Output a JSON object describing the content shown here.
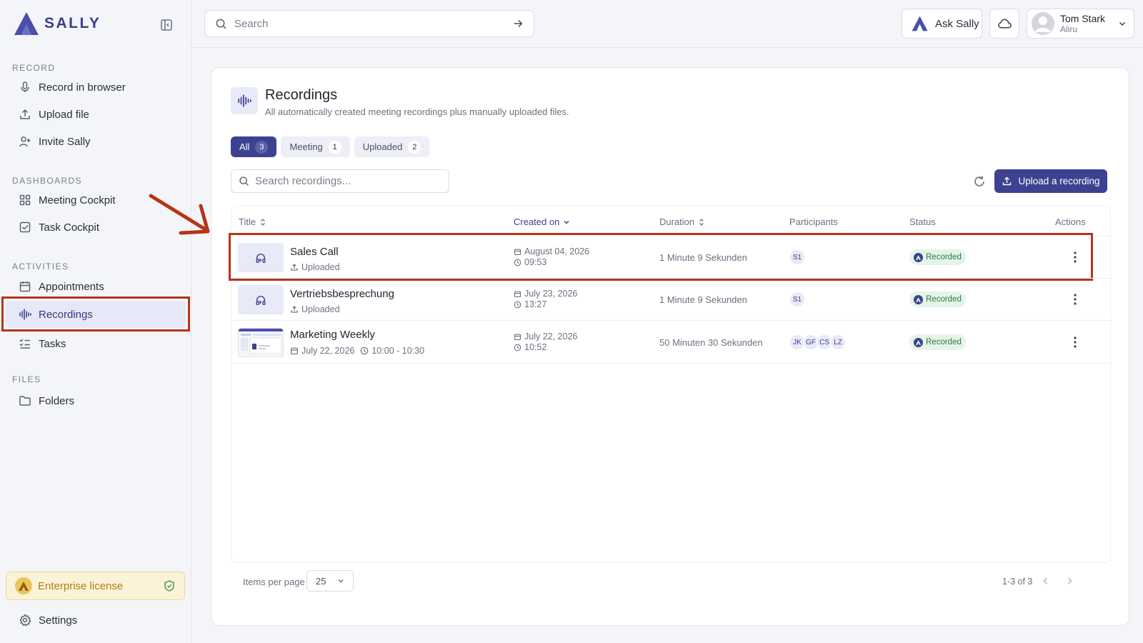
{
  "app": {
    "name": "SALLY"
  },
  "sidebar": {
    "sections": [
      {
        "label": "RECORD",
        "items": [
          {
            "label": "Record in browser",
            "icon": "microphone-icon"
          },
          {
            "label": "Upload file",
            "icon": "upload-icon"
          },
          {
            "label": "Invite Sally",
            "icon": "user-plus-icon"
          }
        ]
      },
      {
        "label": "DASHBOARDS",
        "items": [
          {
            "label": "Meeting Cockpit",
            "icon": "grid-icon"
          },
          {
            "label": "Task Cockpit",
            "icon": "checkbox-icon"
          }
        ]
      },
      {
        "label": "ACTIVITIES",
        "items": [
          {
            "label": "Appointments",
            "icon": "calendar-icon"
          },
          {
            "label": "Recordings",
            "icon": "waveform-icon",
            "active": true
          },
          {
            "label": "Tasks",
            "icon": "checklist-icon"
          }
        ]
      },
      {
        "label": "FILES",
        "items": [
          {
            "label": "Folders",
            "icon": "folder-icon"
          }
        ]
      }
    ],
    "license": "Enterprise license",
    "settings": "Settings"
  },
  "topbar": {
    "search_placeholder": "Search",
    "ask_label": "Ask Sally",
    "user": {
      "name": "Tom Stark",
      "org": "Aliru"
    }
  },
  "page": {
    "title": "Recordings",
    "subtitle": "All automatically created meeting recordings plus manually uploaded files.",
    "tabs": [
      {
        "label": "All",
        "count": "3",
        "active": true
      },
      {
        "label": "Meeting",
        "count": "1"
      },
      {
        "label": "Uploaded",
        "count": "2"
      }
    ],
    "search_placeholder": "Search recordings...",
    "upload_label": "Upload a recording",
    "columns": [
      "Title",
      "Created on",
      "Duration",
      "Participants",
      "Status",
      "Actions"
    ],
    "rows": [
      {
        "title": "Sales Call",
        "meta": "Uploaded",
        "date": "August 04, 2026",
        "time": "09:53",
        "duration": "1 Minute 9 Sekunden",
        "participants": [
          "S1"
        ],
        "status": "Recorded"
      },
      {
        "title": "Vertriebsbesprechung",
        "meta": "Uploaded",
        "date": "July 23, 2026",
        "time": "13:27",
        "duration": "1 Minute 9 Sekunden",
        "participants": [
          "S1"
        ],
        "status": "Recorded"
      },
      {
        "title": "Marketing Weekly",
        "meta_date": "July 22, 2026",
        "meta_time": "10:00 - 10:30",
        "date": "July 22, 2026",
        "time": "10:52",
        "duration": "50 Minuten 30 Sekunden",
        "participants": [
          "JK",
          "GF",
          "CS",
          "LZ"
        ],
        "status": "Recorded"
      }
    ],
    "pager": {
      "label": "Items per page",
      "per_page": "25",
      "range": "1-3 of 3"
    }
  },
  "colors": {
    "brand": "#3c4290",
    "highlight": "#b5351a",
    "status_bg": "#e4f4e8",
    "license_bg": "#fbf3d8"
  }
}
